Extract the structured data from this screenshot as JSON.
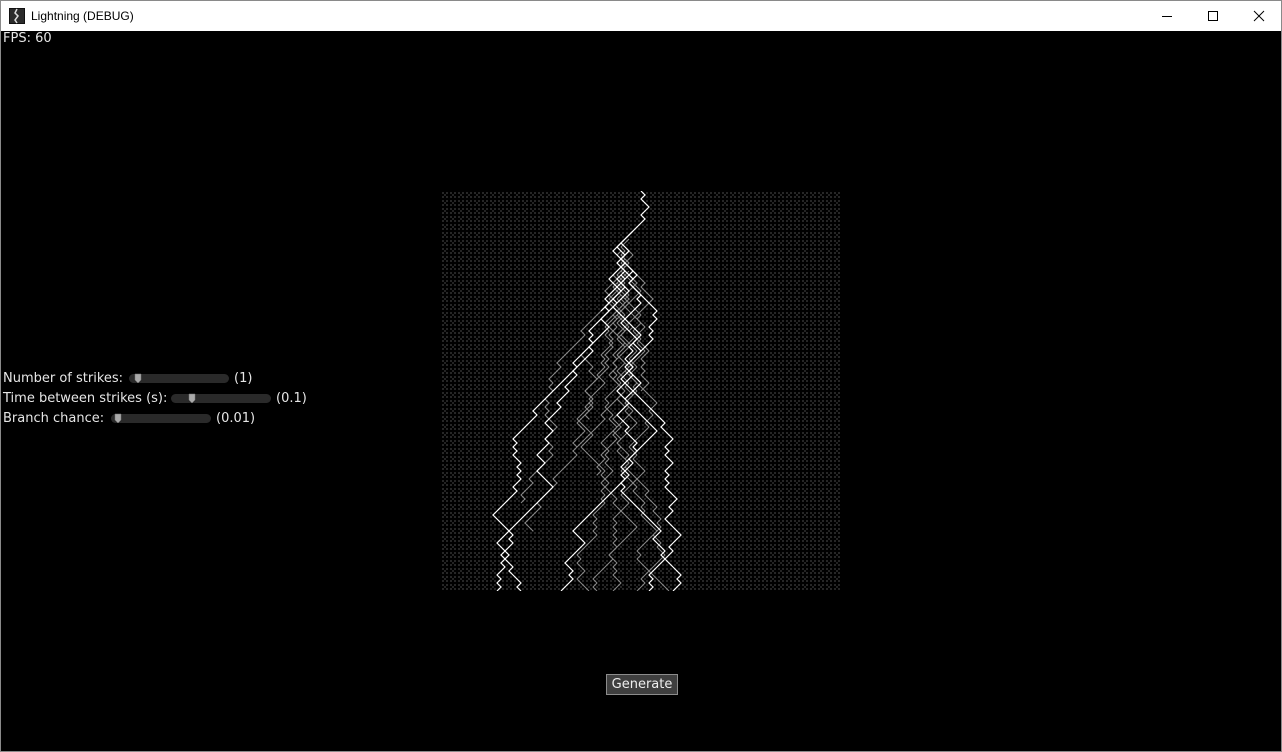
{
  "window": {
    "title": "Lightning (DEBUG)",
    "icons": [
      "app-icon",
      "minimize-icon",
      "maximize-icon",
      "close-icon"
    ]
  },
  "hud": {
    "fps_label": "FPS: 60"
  },
  "controls": {
    "strikes": {
      "label": "Number of strikes:",
      "value_text": "(1)",
      "value": 1,
      "slider_fraction": 0.05
    },
    "time": {
      "label": "Time between strikes (s):",
      "value_text": "(0.1)",
      "value": 0.1,
      "slider_fraction": 0.18
    },
    "branch": {
      "label": "Branch chance:",
      "value_text": "(0.01)",
      "value": 0.01,
      "slider_fraction": 0.03
    }
  },
  "actions": {
    "generate_label": "Generate"
  },
  "colors": {
    "background": "#000000",
    "text": "#e6e6e6",
    "bolt_main": "#ffffff",
    "bolt_branch": "#8a8a8a",
    "grid_dot": "#262626",
    "slider_track": "#2a2a2a",
    "slider_thumb": "#aaaaaa",
    "button_bg": "#3f3f3f"
  }
}
